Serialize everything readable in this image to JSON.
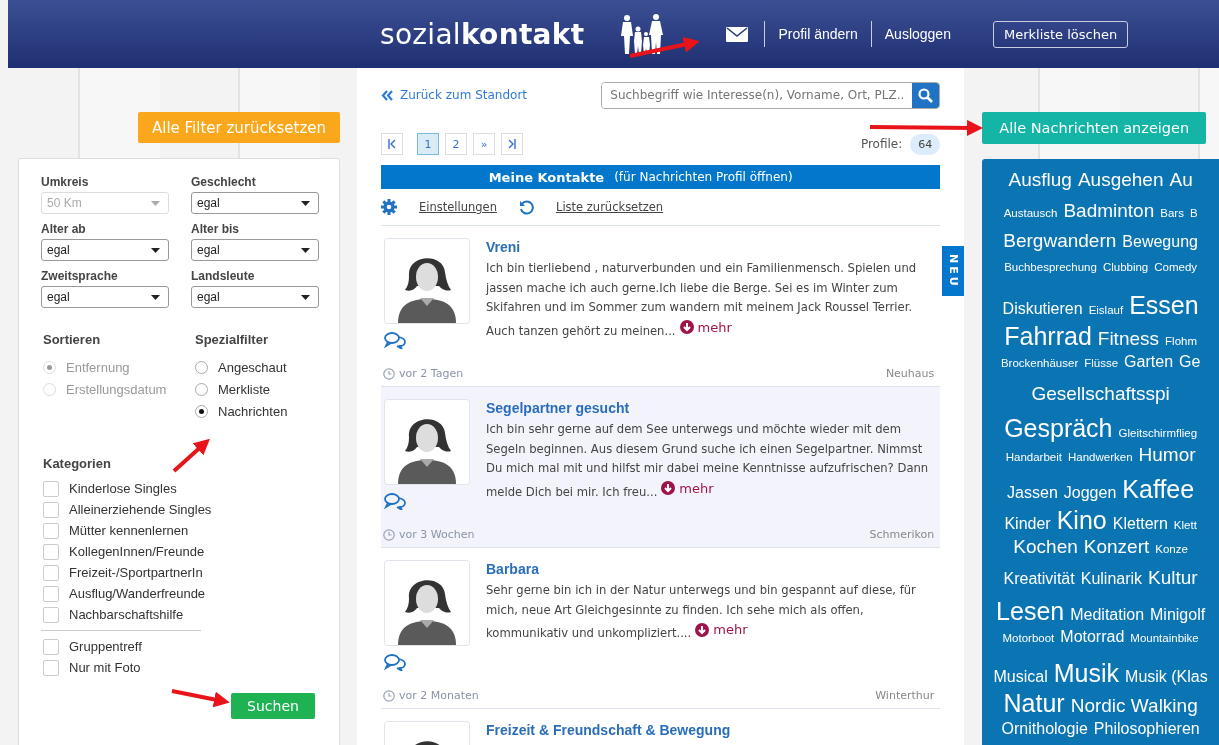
{
  "header": {
    "logo": "sozial**kontakt**",
    "nav_links": [
      "Profil ändern",
      "Ausloggen"
    ],
    "clear_button": "Merkliste löschen"
  },
  "filters": {
    "reset_button": "Alle Filter zurücksetzen",
    "selects": [
      {
        "label": "Umkreis",
        "value": "50 Km",
        "disabled": true
      },
      {
        "label": "Geschlecht",
        "value": "egal",
        "disabled": false
      },
      {
        "label": "Alter ab",
        "value": "egal",
        "disabled": false
      },
      {
        "label": "Alter bis",
        "value": "egal",
        "disabled": false
      },
      {
        "label": "Zweitsprache",
        "value": "egal",
        "disabled": false
      },
      {
        "label": "Landsleute",
        "value": "egal",
        "disabled": false
      }
    ],
    "sort": {
      "title": "Sortieren",
      "options": [
        {
          "label": "Entfernung",
          "selected": true,
          "disabled": true
        },
        {
          "label": "Erstellungsdatum",
          "selected": false,
          "disabled": true
        }
      ]
    },
    "special": {
      "title": "Spezialfilter",
      "options": [
        {
          "label": "Angeschaut",
          "selected": false,
          "disabled": false
        },
        {
          "label": "Merkliste",
          "selected": false,
          "disabled": false
        },
        {
          "label": "Nachrichten",
          "selected": true,
          "disabled": false
        }
      ]
    },
    "categories_title": "Kategorien",
    "categories": [
      [
        {
          "label": "Kinderlose Singles",
          "checked": false
        },
        {
          "label": "Alleinerziehende Singles",
          "checked": false
        },
        {
          "label": "Mütter kennenlernen",
          "checked": false
        },
        {
          "label": "KollegenInnen/Freunde",
          "checked": false
        },
        {
          "label": "Freizeit-/SportpartnerIn",
          "checked": false
        },
        {
          "label": "Ausflug/Wanderfreunde",
          "checked": false
        },
        {
          "label": "Nachbarschaftshilfe",
          "checked": false
        }
      ],
      [
        {
          "label": "Gruppentreff",
          "checked": false
        },
        {
          "label": "Nur mit Foto",
          "checked": false
        }
      ]
    ],
    "search_button": "Suchen"
  },
  "center": {
    "back_link": "Zurück zum Standort",
    "search": {
      "placeholder": "Suchbegriff wie Interesse(n), Vorname, Ort, PLZ.."
    },
    "pagination": [
      {
        "kind": "first",
        "selected": false
      },
      {
        "kind": "page",
        "label": "1",
        "selected": true
      },
      {
        "kind": "page",
        "label": "2",
        "selected": false
      },
      {
        "kind": "page",
        "label": "»",
        "selected": false
      },
      {
        "kind": "last",
        "selected": false
      }
    ],
    "profiles_label": "Profile:",
    "profiles_count": "64",
    "banner": {
      "title": "Meine Kontakte",
      "subtitle": "(für Nachrichten Profil öffnen)"
    },
    "actions": [
      {
        "kind": "settings",
        "label": "Einstellungen"
      },
      {
        "kind": "reset",
        "label": "Liste zurücksetzen"
      }
    ],
    "new_tab": "NEU",
    "listings": [
      {
        "title": "Vreni",
        "text": "Ich bin tierliebend , naturverbunden und ein Familienmensch. Spielen und jassen mache ich auch gerne.Ich liebe die Berge. Sei es im Winter zum Skifahren und im Sommer zum wandern mit meinem Jack Roussel Terrier. Auch tanzen gehört zu meinen...",
        "more": "mehr",
        "time": "vor 2 Tagen",
        "place": "Neuhaus",
        "selected": false
      },
      {
        "title": "Segelpartner gesucht",
        "text": "Ich bin sehr gerne auf dem See unterwegs und möchte wieder mit dem Segeln beginnen. Aus diesem Grund suche ich einen Segelpartner. Nimmst Du mich mal mit und hilfst mir dabei meine Kenntnisse aufzufrischen? Dann melde Dich bei mir. Ich freu...",
        "more": "mehr",
        "time": "vor 3 Wochen",
        "place": "Schmerikon",
        "selected": true
      },
      {
        "title": "Barbara",
        "text": "Sehr gerne bin ich in der Natur unterwegs und bin gespannt auf diese, für mich, neue Art Gleichgesinnte zu finden. Ich sehe mich als offen, kommunikativ und unkompliziert....",
        "more": "mehr",
        "time": "vor 2 Monaten",
        "place": "Winterthur",
        "selected": false
      },
      {
        "title": "Freizeit & Freundschaft & Bewegung",
        "selected": false
      }
    ]
  },
  "right": {
    "messages_button": "Alle Nachrichten anzeigen",
    "tags": [
      [
        {
          "text": "Ausflug",
          "kind": "l"
        },
        {
          "text": "Ausgehen",
          "kind": "l"
        },
        {
          "text": "Au",
          "kind": "l"
        }
      ],
      [
        {
          "text": "Austausch",
          "kind": "s"
        },
        {
          "text": "Badminton",
          "kind": "l"
        },
        {
          "text": "Bars",
          "kind": "s"
        },
        {
          "text": "B",
          "kind": "s"
        }
      ],
      [
        {
          "text": "Bergwandern",
          "kind": "l"
        },
        {
          "text": "Bewegung",
          "kind": "m"
        }
      ],
      [
        {
          "text": "Buchbesprechung",
          "kind": "s"
        },
        {
          "text": "Clubbing",
          "kind": "s"
        },
        {
          "text": "Comedy",
          "kind": "s"
        }
      ],
      [
        {
          "text": "Diskutieren",
          "kind": "m"
        },
        {
          "text": "Eislauf",
          "kind": "s"
        },
        {
          "text": "Essen",
          "kind": "xl"
        }
      ],
      [
        {
          "text": "Fahrrad",
          "kind": "xl"
        },
        {
          "text": "Fitness",
          "kind": "l"
        },
        {
          "text": "Flohm",
          "kind": "s"
        }
      ],
      [
        {
          "text": "Brockenhäuser",
          "kind": "s"
        },
        {
          "text": "Flüsse",
          "kind": "s"
        },
        {
          "text": "Garten",
          "kind": "m"
        },
        {
          "text": "Ge",
          "kind": "m"
        }
      ],
      [
        {
          "text": "Gesellschaftsspi",
          "kind": "l"
        }
      ],
      [
        {
          "text": "Gespräch",
          "kind": "xl"
        },
        {
          "text": "Gleitschirmflieg",
          "kind": "s"
        }
      ],
      [
        {
          "text": "Handarbeit",
          "kind": "s"
        },
        {
          "text": "Handwerken",
          "kind": "s"
        },
        {
          "text": "Humor",
          "kind": "l"
        }
      ],
      [
        {
          "text": "Jassen",
          "kind": "m"
        },
        {
          "text": "Joggen",
          "kind": "m"
        },
        {
          "text": "Kaffee",
          "kind": "xl"
        }
      ],
      [
        {
          "text": "Kinder",
          "kind": "m"
        },
        {
          "text": "Kino",
          "kind": "xl"
        },
        {
          "text": "Klettern",
          "kind": "m"
        },
        {
          "text": "Klett",
          "kind": "s"
        }
      ],
      [
        {
          "text": "Kochen",
          "kind": "l"
        },
        {
          "text": "Konzert",
          "kind": "l"
        },
        {
          "text": "Konze",
          "kind": "s"
        }
      ],
      [
        {
          "text": "Kreativität",
          "kind": "m"
        },
        {
          "text": "Kulinarik",
          "kind": "m"
        },
        {
          "text": "Kultur",
          "kind": "l"
        }
      ],
      [
        {
          "text": "Lesen",
          "kind": "xl"
        },
        {
          "text": "Meditation",
          "kind": "m"
        },
        {
          "text": "Minigolf",
          "kind": "m"
        }
      ],
      [
        {
          "text": "Motorboot",
          "kind": "s"
        },
        {
          "text": "Motorrad",
          "kind": "m"
        },
        {
          "text": "Mountainbike",
          "kind": "s"
        }
      ],
      [
        {
          "text": "Musical",
          "kind": "m"
        },
        {
          "text": "Musik",
          "kind": "xl"
        },
        {
          "text": "Musik (Klas",
          "kind": "m"
        }
      ],
      [
        {
          "text": "Natur",
          "kind": "xl"
        },
        {
          "text": "Nordic Walking",
          "kind": "l"
        }
      ],
      [
        {
          "text": "Ornithologie",
          "kind": "m"
        },
        {
          "text": "Philosophieren",
          "kind": "m"
        }
      ]
    ]
  }
}
